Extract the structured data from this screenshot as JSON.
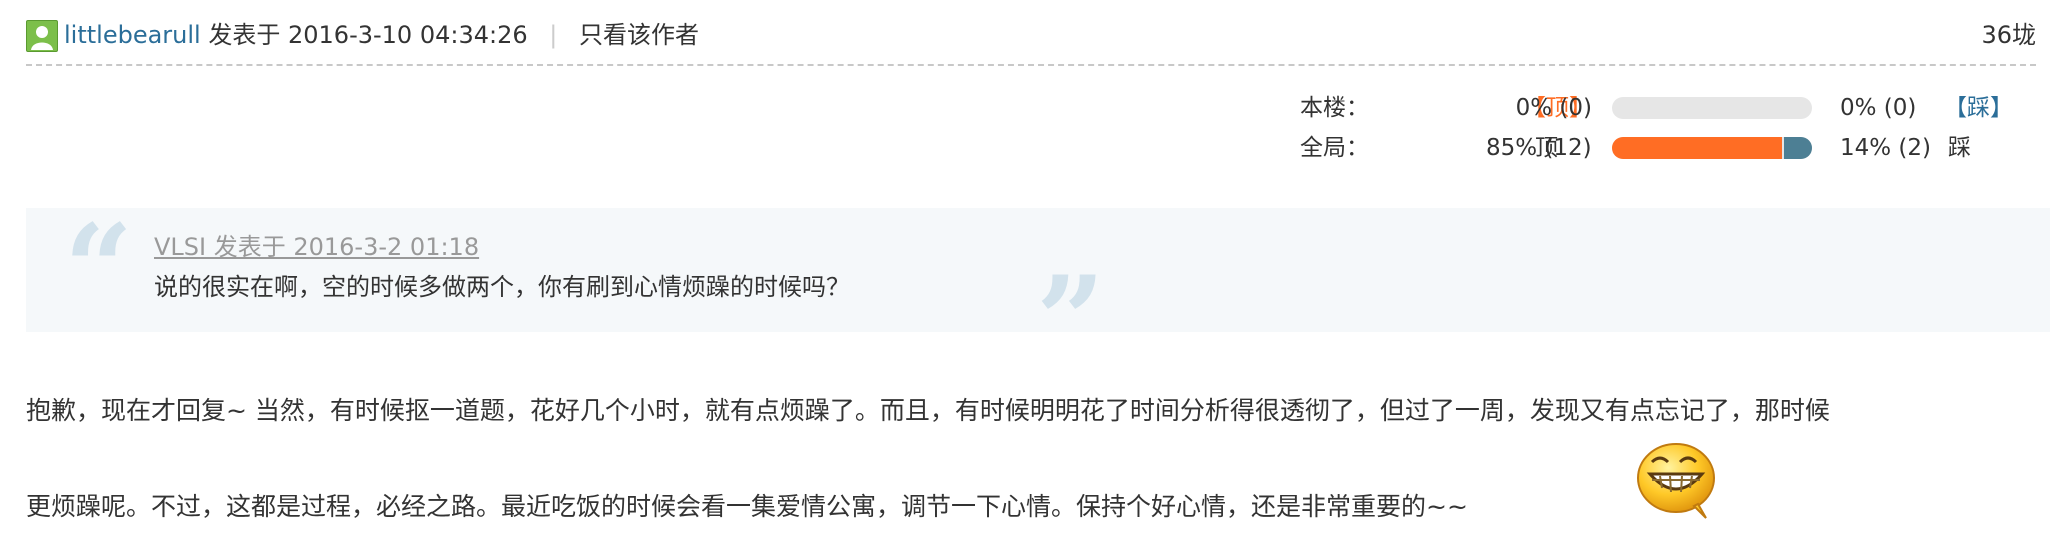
{
  "post_header": {
    "username": "littlebearull",
    "posted_at": "发表于 2016-3-10 04:34:26",
    "separator": "|",
    "only_author": "只看该作者",
    "floor": "36垅"
  },
  "vote": {
    "this_floor": {
      "label": "本楼：",
      "up_label": "【顶】",
      "up_value": "0% (0)",
      "down_value": "0% (0)",
      "down_label": "【踩】",
      "up_fraction": 0,
      "down_fraction": 0
    },
    "global": {
      "label": "全局：",
      "up_label": "顶",
      "up_value": "85% (12)",
      "down_value": "14% (2)",
      "down_label": "踩",
      "up_fraction": 0.85,
      "down_fraction": 0.14
    }
  },
  "quote": {
    "cite": "VLSI 发表于 2016-3-2 01:18",
    "text": "说的很实在啊，空的时候多做两个，你有刷到心情烦躁的时候吗？"
  },
  "reply": {
    "line1": "抱歉，现在才回复~ 当然，有时候抠一道题，花好几个小时，就有点烦躁了。而且，有时候明明花了时间分析得很透彻了，但过了一周，发现又有点忘记了，那时候",
    "line2": "更烦躁呢。不过，这都是过程，必经之路。最近吃饭的时候会看一集爱情公寓，调节一下心情。保持个好心情，还是非常重要的~~"
  },
  "emoticon": "grinning-face-icon",
  "colors": {
    "link": "#2b6e99",
    "up": "#ff6d24",
    "down": "#4d7f94",
    "quote_bg": "#f5f8fa"
  }
}
